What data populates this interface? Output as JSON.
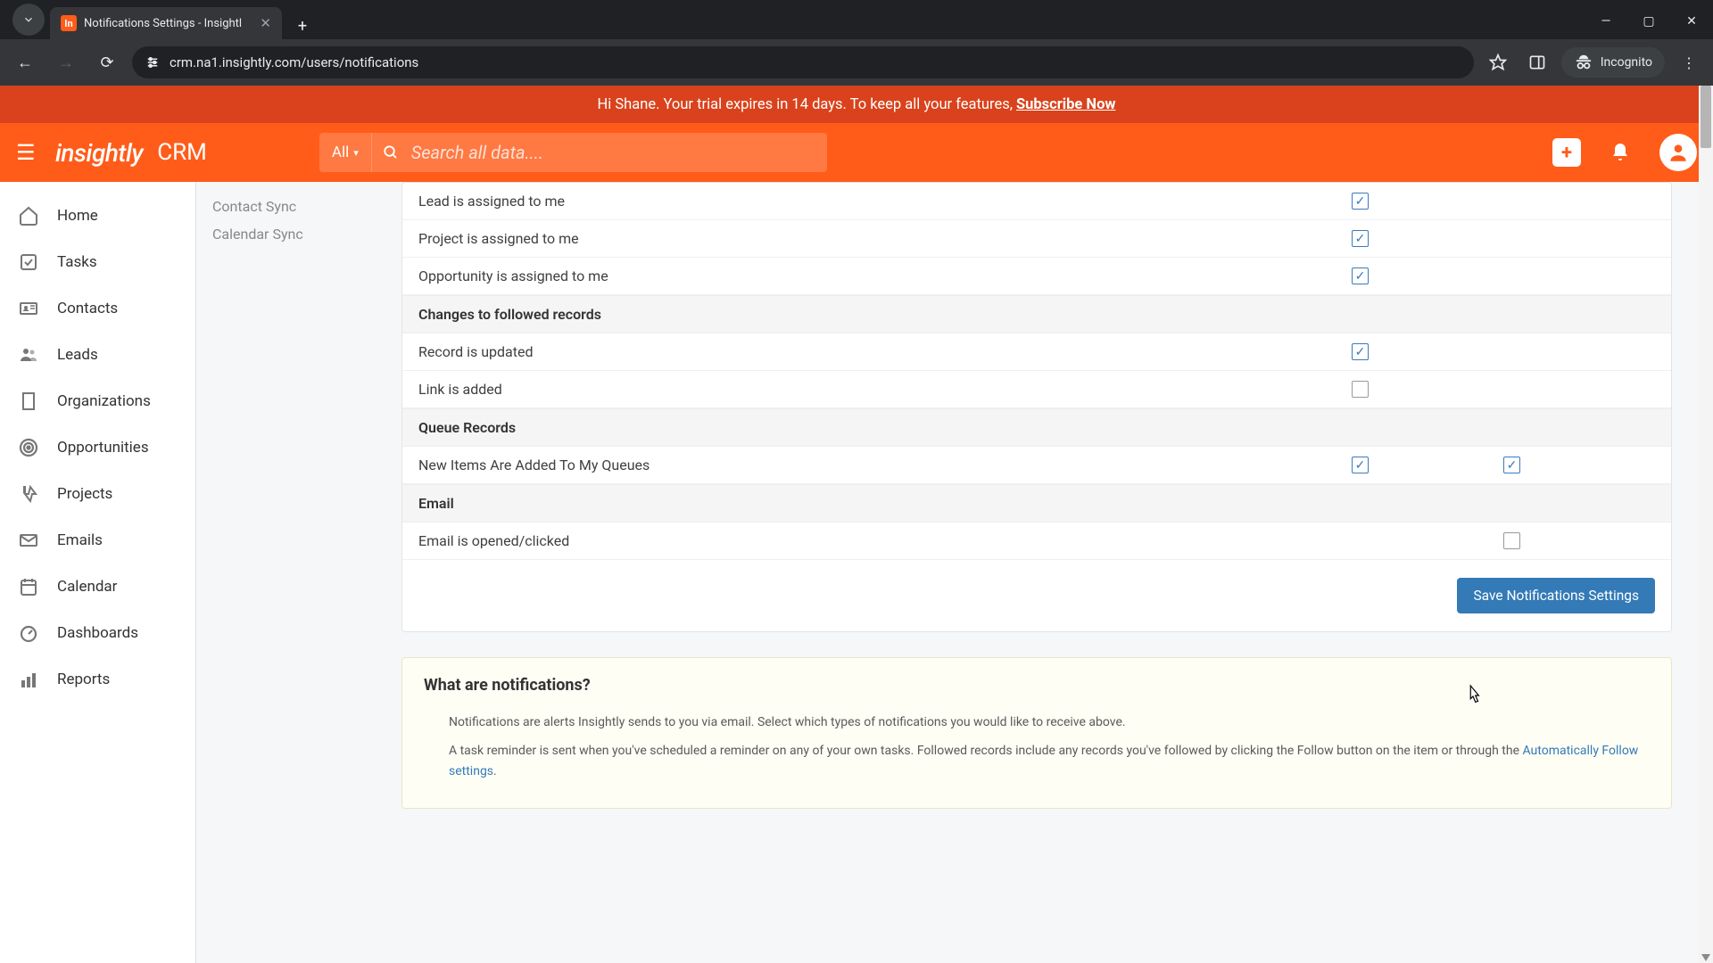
{
  "browser": {
    "tab_title": "Notifications Settings - Insightl",
    "url": "crm.na1.insightly.com/users/notifications",
    "incognito_label": "Incognito"
  },
  "trial_banner": {
    "text": "Hi Shane. Your trial expires in 14 days. To keep all your features, ",
    "link": "Subscribe Now"
  },
  "header": {
    "logo": "insightly",
    "app": "CRM",
    "search_scope": "All",
    "search_placeholder": "Search all data...."
  },
  "nav": {
    "items": [
      {
        "label": "Home"
      },
      {
        "label": "Tasks"
      },
      {
        "label": "Contacts"
      },
      {
        "label": "Leads"
      },
      {
        "label": "Organizations"
      },
      {
        "label": "Opportunities"
      },
      {
        "label": "Projects"
      },
      {
        "label": "Emails"
      },
      {
        "label": "Calendar"
      },
      {
        "label": "Dashboards"
      },
      {
        "label": "Reports"
      }
    ]
  },
  "settings_nav": {
    "items": [
      {
        "label": "Contact Sync"
      },
      {
        "label": "Calendar Sync"
      }
    ]
  },
  "notifications": {
    "rows_top": [
      {
        "label": "Lead is assigned to me",
        "c1": true
      },
      {
        "label": "Project is assigned to me",
        "c1": true
      },
      {
        "label": "Opportunity is assigned to me",
        "c1": true
      }
    ],
    "section_followed": "Changes to followed records",
    "rows_followed": [
      {
        "label": "Record is updated",
        "c1": true
      },
      {
        "label": "Link is added",
        "c1": false
      }
    ],
    "section_queue": "Queue Records",
    "rows_queue": [
      {
        "label": "New Items Are Added To My Queues",
        "c1": true,
        "c2": true
      }
    ],
    "section_email": "Email",
    "rows_email": [
      {
        "label": "Email is opened/clicked",
        "c2": false
      }
    ],
    "save_label": "Save Notifications Settings"
  },
  "info": {
    "title": "What are notifications?",
    "p1": "Notifications are alerts Insightly sends to you via email. Select which types of notifications you would like to receive above.",
    "p2a": "A task reminder is sent when you've scheduled a reminder on any of your own tasks. Followed records include any records you've followed by clicking the Follow button on the item or through the ",
    "p2link": "Automatically Follow settings",
    "p2b": "."
  }
}
